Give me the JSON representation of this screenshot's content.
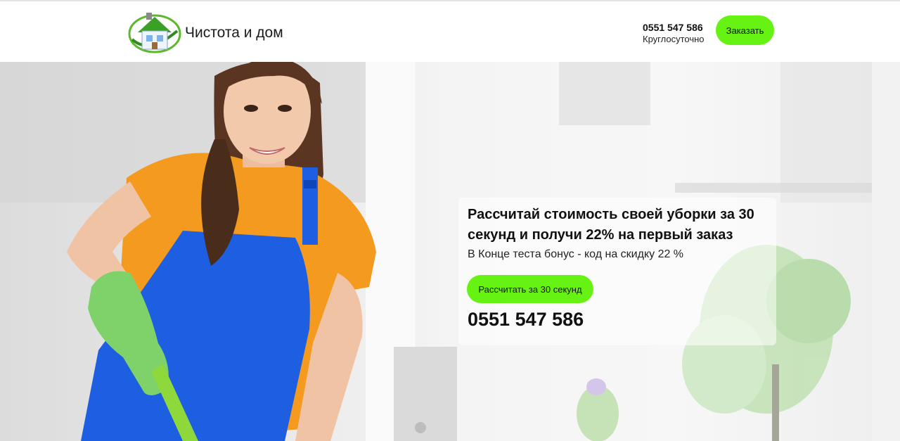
{
  "header": {
    "brand": "Чистота и дом",
    "phone": "0551 547 586",
    "hours": "Круглосуточно",
    "order_label": "Заказать"
  },
  "hero": {
    "title": "Рассчитай стоимость своей уборки за 30 секунд и получи 22% на первый заказ",
    "subtitle": "В Конце теста бонус - код на скидку 22 %",
    "cta_label": "Рассчитать за 30 секунд",
    "phone": "0551 547 586"
  },
  "colors": {
    "accent": "#66f313",
    "apron": "#1d5fe0",
    "shirt": "#f39a1f",
    "glove": "#7fd26a"
  },
  "icons": [
    "house-logo-icon"
  ]
}
